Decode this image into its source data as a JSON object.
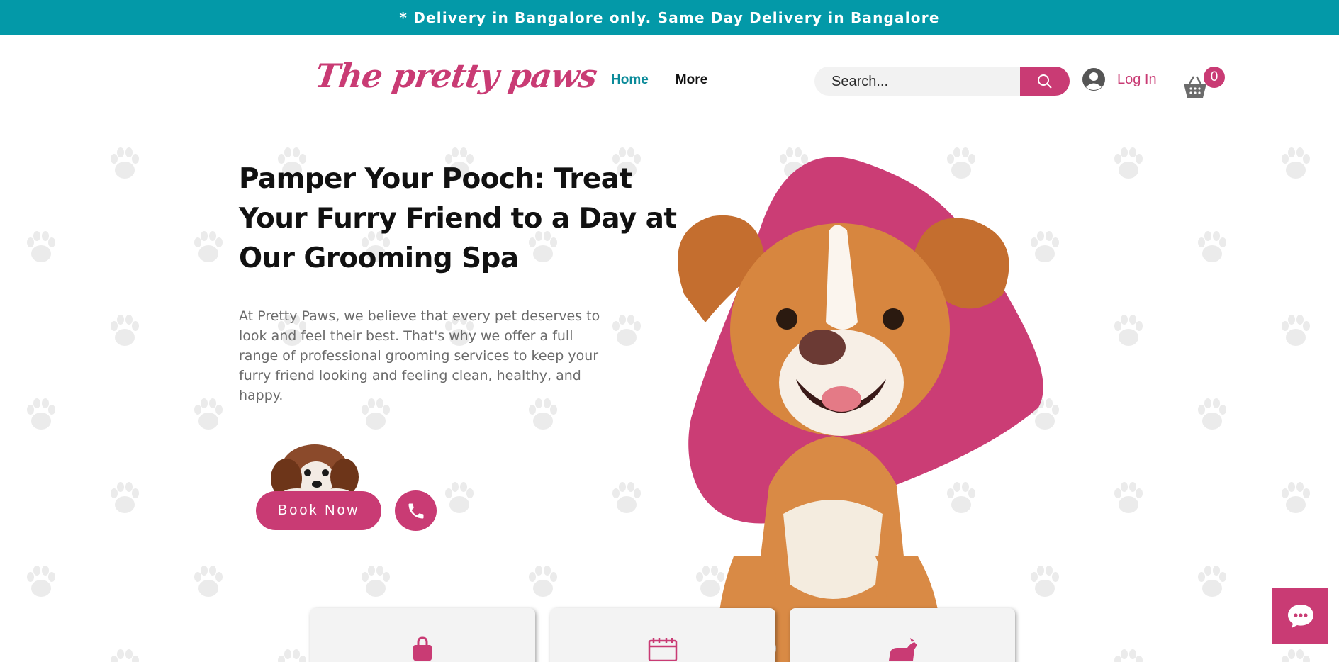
{
  "announcement": "* Delivery in Bangalore only. Same Day Delivery in Bangalore",
  "header": {
    "logo": "The pretty paws",
    "nav": {
      "home": "Home",
      "more": "More"
    },
    "search": {
      "placeholder": "Search..."
    },
    "login_label": "Log In",
    "cart_count": "0"
  },
  "hero": {
    "headline": "Pamper Your Pooch: Treat Your Furry Friend to a Day at Our Grooming Spa",
    "description": "At Pretty Paws, we believe that every pet deserves to look and feel their best. That's why we offer a full range of professional grooming services to keep your furry friend looking and feeling clean, healthy, and happy.",
    "book_label": "Book Now"
  },
  "cards": [
    {
      "icon": "shopping-bag-icon"
    },
    {
      "icon": "calendar-icon"
    },
    {
      "icon": "dog-icon"
    }
  ],
  "colors": {
    "announce_bar": "#0399a8",
    "brand_pink": "#c93b74",
    "nav_active": "#0a8a99"
  }
}
